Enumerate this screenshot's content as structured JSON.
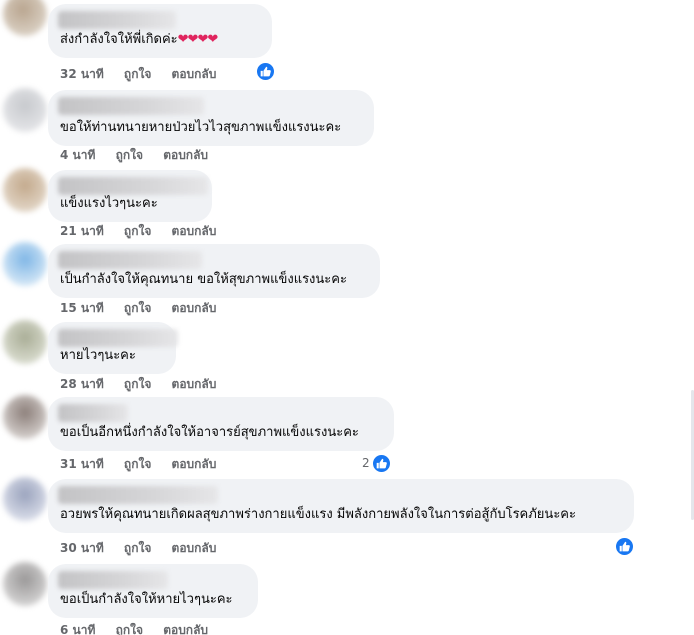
{
  "labels": {
    "like": "ถูกใจ",
    "reply": "ตอบกลับ"
  },
  "colors": {
    "like_blue": "#1877f2",
    "heart_red": "#e0245e",
    "bubble_bg": "#f0f2f5",
    "meta_gray": "#65676b"
  },
  "comments": [
    {
      "text": "ส่งกำลังใจให้พี่เกิดค่ะ",
      "emoji": "❤❤❤❤",
      "time": "32 นาที",
      "reactions": {
        "icon": "like-icon",
        "count": ""
      }
    },
    {
      "text": "ขอให้ท่านทนายหายป่วยไวไวสุขภาพแข็งแรงนะคะ",
      "time": "4 นาที"
    },
    {
      "text": "แข็งแรงไวๆนะคะ",
      "time": "21 นาที"
    },
    {
      "text": "เป็นกำลังใจให้คุณทนาย ขอให้สุขภาพแข็งแรงนะคะ",
      "time": "15 นาที"
    },
    {
      "text": "หายไวๆนะคะ",
      "time": "28 นาที"
    },
    {
      "text": "ขอเป็นอีกหนึ่งกำลังใจให้อาจารย์สุขภาพแข็งแรงนะคะ",
      "time": "31 นาที",
      "reactions": {
        "icon": "like-icon",
        "count": "2"
      }
    },
    {
      "text": "อวยพรให้คุณทนายเกิดผลสุขภาพร่างกายแข็งแรง มีพลังกายพลังใจในการต่อสู้กับโรคภัยนะคะ",
      "time": "30 นาที",
      "reactions": {
        "icon": "like-icon",
        "count": ""
      }
    },
    {
      "text": "ขอเป็นกำลังใจให้หายไวๆนะคะ",
      "time": "6 นาที"
    }
  ]
}
